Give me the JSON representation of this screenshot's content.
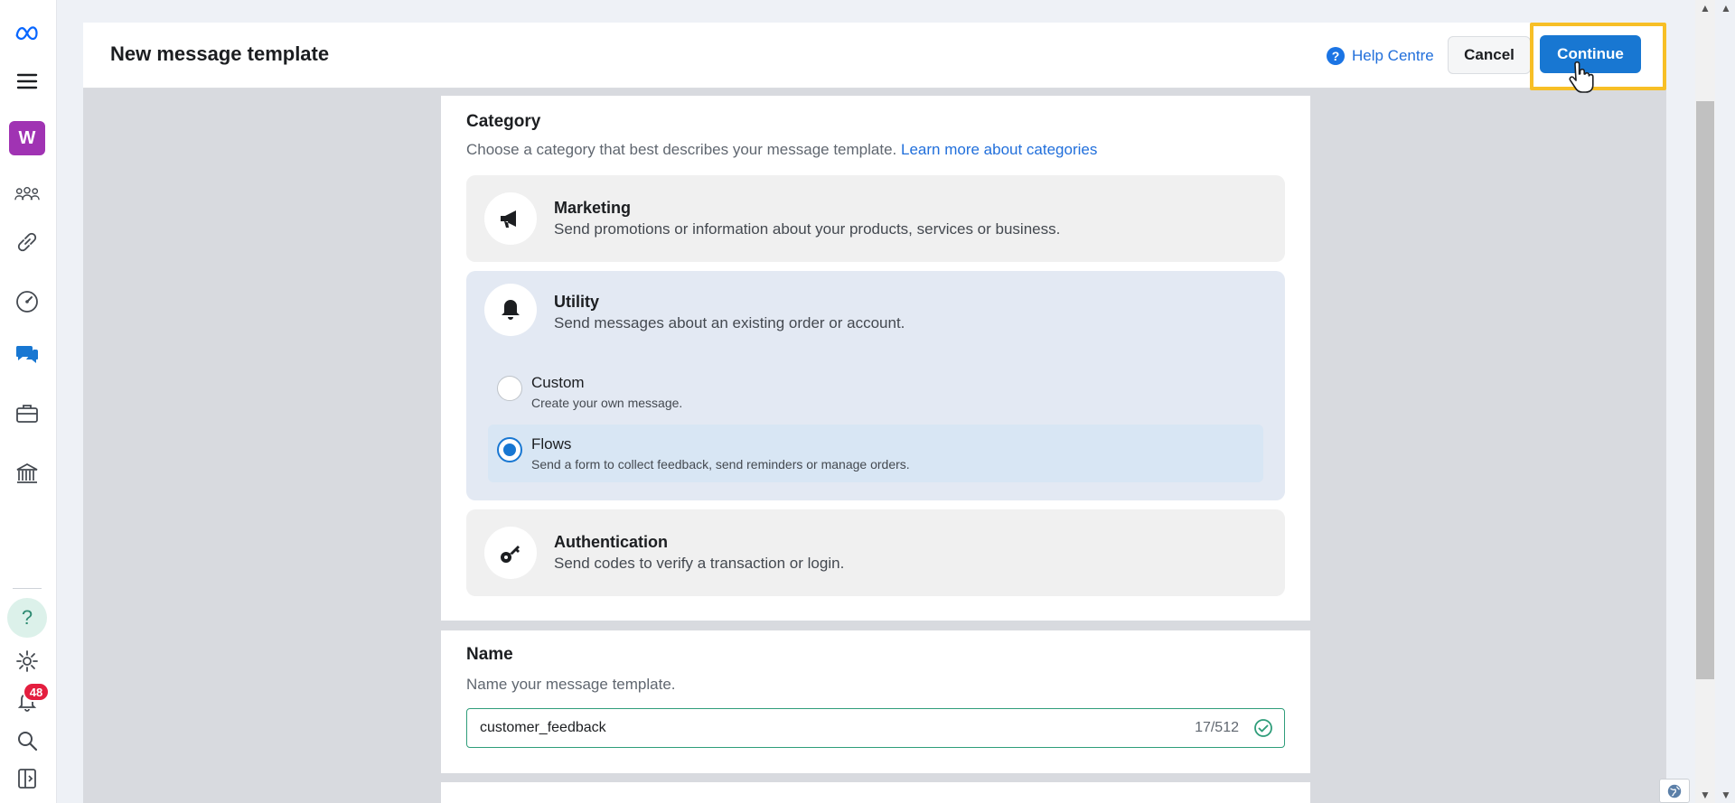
{
  "header": {
    "title": "New message template",
    "help_label": "Help Centre",
    "cancel_label": "Cancel",
    "continue_label": "Continue"
  },
  "sidebar": {
    "workspace_initial": "W",
    "help_glyph": "?",
    "notifications_count": "48",
    "items": [
      {
        "icon": "meta-logo-icon"
      },
      {
        "icon": "menu-icon"
      },
      {
        "icon": "people-icon"
      },
      {
        "icon": "link-icon"
      },
      {
        "icon": "dashboard-icon"
      },
      {
        "icon": "chat-icon"
      },
      {
        "icon": "briefcase-icon"
      },
      {
        "icon": "bank-icon"
      },
      {
        "icon": "settings-icon"
      },
      {
        "icon": "bell-icon"
      },
      {
        "icon": "search-icon"
      },
      {
        "icon": "panel-toggle-icon"
      }
    ]
  },
  "category": {
    "title": "Category",
    "description": "Choose a category that best describes your message template.",
    "learn_more": "Learn more about categories",
    "options": [
      {
        "title": "Marketing",
        "description": "Send promotions or information about your products, services or business.",
        "icon": "megaphone-icon"
      },
      {
        "title": "Utility",
        "description": "Send messages about an existing order or account.",
        "icon": "bell-icon"
      },
      {
        "title": "Authentication",
        "description": "Send codes to verify a transaction or login.",
        "icon": "key-icon"
      }
    ],
    "utility_types": [
      {
        "title": "Custom",
        "description": "Create your own message.",
        "selected": false
      },
      {
        "title": "Flows",
        "description": "Send a form to collect feedback, send reminders or manage orders.",
        "selected": true
      }
    ]
  },
  "name": {
    "title": "Name",
    "description": "Name your message template.",
    "value": "customer_feedback",
    "counter": "17/512"
  },
  "colors": {
    "primary": "#1877d2",
    "highlight": "#f7bf26",
    "valid": "#2f9d7a",
    "badge": "#e41e3f"
  }
}
